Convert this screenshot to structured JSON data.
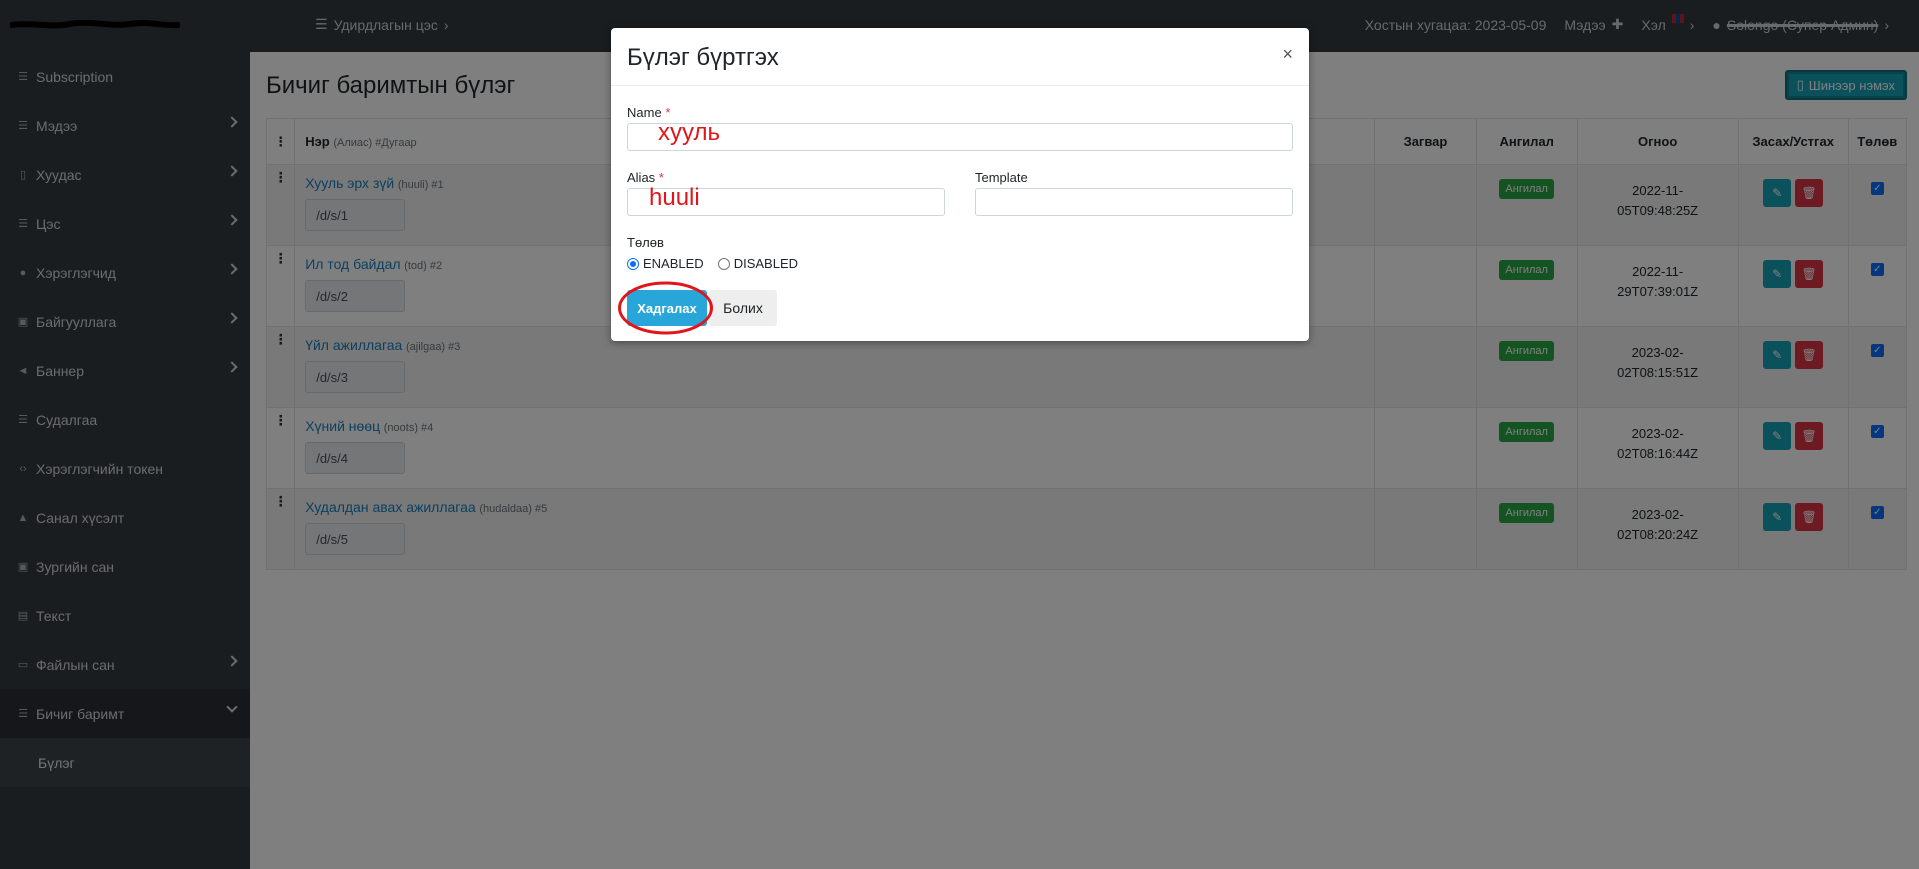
{
  "topbar": {
    "menu_label": "Удирдлагын цэс",
    "hosting_expiry": "Хостын хугацаа: 2023-05-09",
    "news_label": "Мэдээ",
    "lang_label": "Хэл",
    "user_label": "Solongo (Супер Админ)"
  },
  "sidebar": {
    "items": [
      {
        "label": "Subscription",
        "icon": "list-icon",
        "has_children": false
      },
      {
        "label": "Мэдээ",
        "icon": "list-icon",
        "has_children": true
      },
      {
        "label": "Хуудас",
        "icon": "file-icon",
        "has_children": true
      },
      {
        "label": "Цэс",
        "icon": "list-icon",
        "has_children": true
      },
      {
        "label": "Хэрэглэгчид",
        "icon": "user-icon",
        "has_children": true
      },
      {
        "label": "Байгууллага",
        "icon": "image-icon",
        "has_children": true
      },
      {
        "label": "Баннер",
        "icon": "megaphone-icon",
        "has_children": true
      },
      {
        "label": "Судалгаа",
        "icon": "list-icon",
        "has_children": false
      },
      {
        "label": "Хэрэглэгчийн токен",
        "icon": "code-icon",
        "has_children": false
      },
      {
        "label": "Санал хүсэлт",
        "icon": "thumbs-up-icon",
        "has_children": false
      },
      {
        "label": "Зургийн сан",
        "icon": "image-icon",
        "has_children": false
      },
      {
        "label": "Текст",
        "icon": "document-icon",
        "has_children": false
      },
      {
        "label": "Файлын сан",
        "icon": "folder-icon",
        "has_children": true
      },
      {
        "label": "Бичиг баримт",
        "icon": "list-icon",
        "has_children": true,
        "open": true
      }
    ],
    "sub_item": "Бүлэг"
  },
  "main": {
    "title": "Бичиг баримтын бүлэг",
    "add_button": "Шинээр нэмэх",
    "columns": {
      "name": "Нэр",
      "name_hint": "(Алиас) #Дугаар",
      "template": "Загвар",
      "category": "Ангилал",
      "date": "Огноо",
      "actions": "Засах/Устгах",
      "status": "Төлөв"
    },
    "rows": [
      {
        "name": "Хууль эрх зүй",
        "alias": "(huuli) #1",
        "path": "/d/s/1",
        "badge": "Ангилал",
        "date1": "2022-11-",
        "date2": "05T09:48:25Z"
      },
      {
        "name": "Ил тод байдал",
        "alias": "(tod) #2",
        "path": "/d/s/2",
        "badge": "Ангилал",
        "date1": "2022-11-",
        "date2": "29T07:39:01Z"
      },
      {
        "name": "Үйл ажиллагаа",
        "alias": "(ajilgaa) #3",
        "path": "/d/s/3",
        "badge": "Ангилал",
        "date1": "2023-02-",
        "date2": "02T08:15:51Z"
      },
      {
        "name": "Хүний нөөц",
        "alias": "(noots) #4",
        "path": "/d/s/4",
        "badge": "Ангилал",
        "date1": "2023-02-",
        "date2": "02T08:16:44Z"
      },
      {
        "name": "Худалдан авах ажиллагаа",
        "alias": "(hudaldaa) #5",
        "path": "/d/s/5",
        "badge": "Ангилал",
        "date1": "2023-02-",
        "date2": "02T08:20:24Z"
      }
    ]
  },
  "modal": {
    "title": "Бүлэг бүртгэх",
    "close": "×",
    "name_label": "Name",
    "name_value": "хууль",
    "alias_label": "Alias",
    "alias_value": "huuli",
    "template_label": "Template",
    "status_label": "Төлөв",
    "status_options": [
      "ENABLED",
      "DISABLED"
    ],
    "status_selected": "ENABLED",
    "save_button": "Хадгалах",
    "cancel_button": "Болих",
    "required_mark": "*",
    "highlight_color": "#e0161c"
  }
}
